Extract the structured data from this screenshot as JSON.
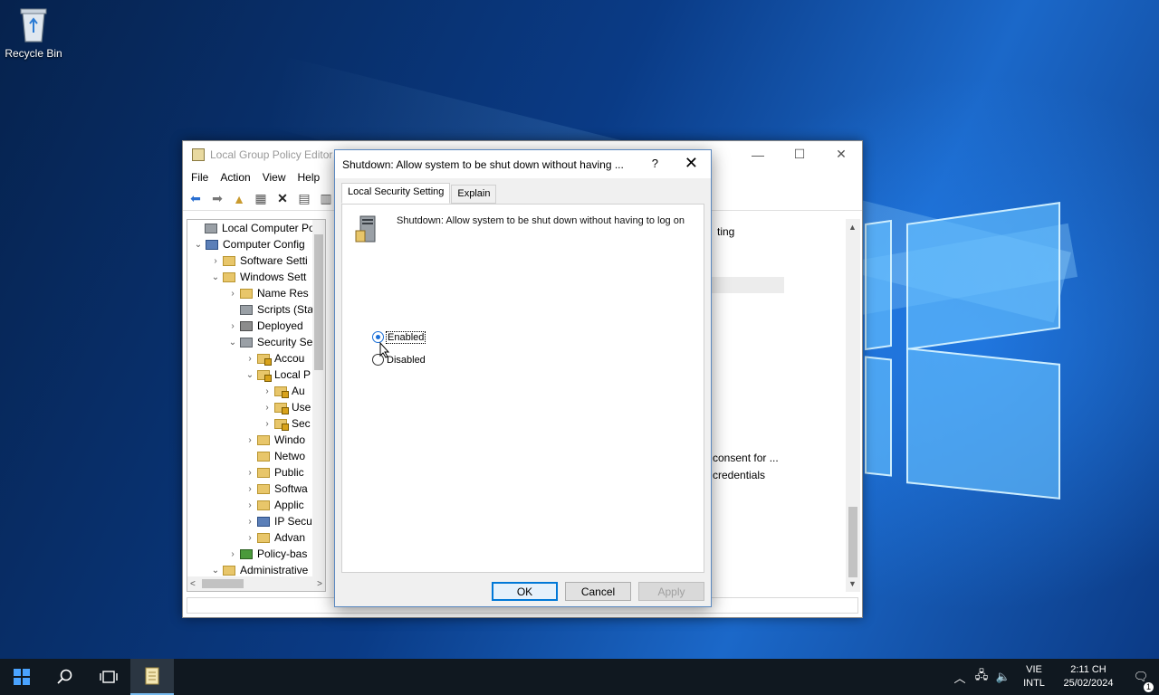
{
  "desktop": {
    "recycle_bin_label": "Recycle Bin"
  },
  "gpedit": {
    "title": "Local Group Policy Editor",
    "menu": [
      "File",
      "Action",
      "View",
      "Help"
    ],
    "tree": [
      {
        "label": "Local Computer Polic",
        "indent": 0,
        "twisty": "",
        "icon": "gear"
      },
      {
        "label": "Computer Config",
        "indent": 0,
        "twisty": "v",
        "icon": "comp"
      },
      {
        "label": "Software Setti",
        "indent": 1,
        "twisty": ">",
        "icon": "folder"
      },
      {
        "label": "Windows Sett",
        "indent": 1,
        "twisty": "v",
        "icon": "folder"
      },
      {
        "label": "Name Res",
        "indent": 2,
        "twisty": ">",
        "icon": "folder"
      },
      {
        "label": "Scripts (Sta",
        "indent": 2,
        "twisty": "",
        "icon": "gear"
      },
      {
        "label": "Deployed",
        "indent": 2,
        "twisty": ">",
        "icon": "printer"
      },
      {
        "label": "Security Se",
        "indent": 2,
        "twisty": "v",
        "icon": "gear"
      },
      {
        "label": "Accou",
        "indent": 3,
        "twisty": ">",
        "icon": "lock"
      },
      {
        "label": "Local P",
        "indent": 3,
        "twisty": "v",
        "icon": "lock"
      },
      {
        "label": "Au",
        "indent": 4,
        "twisty": ">",
        "icon": "lock"
      },
      {
        "label": "Use",
        "indent": 4,
        "twisty": ">",
        "icon": "lock"
      },
      {
        "label": "Sec",
        "indent": 4,
        "twisty": ">",
        "icon": "lock"
      },
      {
        "label": "Windo",
        "indent": 3,
        "twisty": ">",
        "icon": "folder"
      },
      {
        "label": "Netwo",
        "indent": 3,
        "twisty": "",
        "icon": "folder"
      },
      {
        "label": "Public",
        "indent": 3,
        "twisty": ">",
        "icon": "folder"
      },
      {
        "label": "Softwa",
        "indent": 3,
        "twisty": ">",
        "icon": "folder"
      },
      {
        "label": "Applic",
        "indent": 3,
        "twisty": ">",
        "icon": "folder"
      },
      {
        "label": "IP Secu",
        "indent": 3,
        "twisty": ">",
        "icon": "comp"
      },
      {
        "label": "Advan",
        "indent": 3,
        "twisty": ">",
        "icon": "folder"
      },
      {
        "label": "Policy-bas",
        "indent": 2,
        "twisty": ">",
        "icon": "chart"
      },
      {
        "label": "Administrative",
        "indent": 1,
        "twisty": "v",
        "icon": "folder"
      }
    ],
    "right_pane": {
      "header_fragment": "ting",
      "line1": "consent for ...",
      "line2": "credentials"
    }
  },
  "dialog": {
    "title": "Shutdown: Allow system to be shut down without having ...",
    "help": "?",
    "close": "✕",
    "tabs": [
      "Local Security Setting",
      "Explain"
    ],
    "policy_name": "Shutdown: Allow system to be shut down without having to log on",
    "options": [
      {
        "label": "Enabled",
        "checked": true
      },
      {
        "label": "Disabled",
        "checked": false
      }
    ],
    "buttons": {
      "ok": "OK",
      "cancel": "Cancel",
      "apply": "Apply"
    }
  },
  "taskbar": {
    "language_top": "VIE",
    "language_bottom": "INTL",
    "time": "2:11 CH",
    "date": "25/02/2024",
    "notification_count": "1"
  }
}
